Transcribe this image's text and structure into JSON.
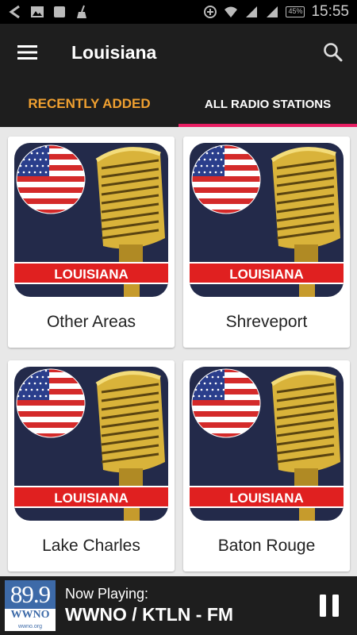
{
  "status_bar": {
    "time": "15:55",
    "battery": "45%",
    "icons": [
      "back-arrow-icon",
      "image-icon",
      "square-icon",
      "broom-icon",
      "data-saver-icon",
      "wifi-icon",
      "signal-icon",
      "signal-icon",
      "battery-icon"
    ]
  },
  "app_bar": {
    "title": "Louisiana",
    "menu_icon": "hamburger-menu-icon",
    "search_icon": "search-icon"
  },
  "tabs": [
    {
      "label": "RECENTLY ADDED",
      "active": false
    },
    {
      "label": "ALL RADIO STATIONS",
      "active": true
    }
  ],
  "cards": [
    {
      "label": "Other Areas",
      "image_text": "LOUISIANA"
    },
    {
      "label": "Shreveport",
      "image_text": "LOUISIANA"
    },
    {
      "label": "Lake Charles",
      "image_text": "LOUISIANA"
    },
    {
      "label": "Baton Rouge",
      "image_text": "LOUISIANA"
    }
  ],
  "player": {
    "now_playing_label": "Now Playing:",
    "station": "WWNO / KTLN - FM",
    "logo": {
      "frequency": "89.9",
      "call": "WWNO",
      "url": "wwno.org"
    },
    "pause_icon": "pause-icon"
  },
  "colors": {
    "accent": "#e91e63",
    "tab_inactive": "#f0a030",
    "bar_bg": "#1e1e1e"
  }
}
